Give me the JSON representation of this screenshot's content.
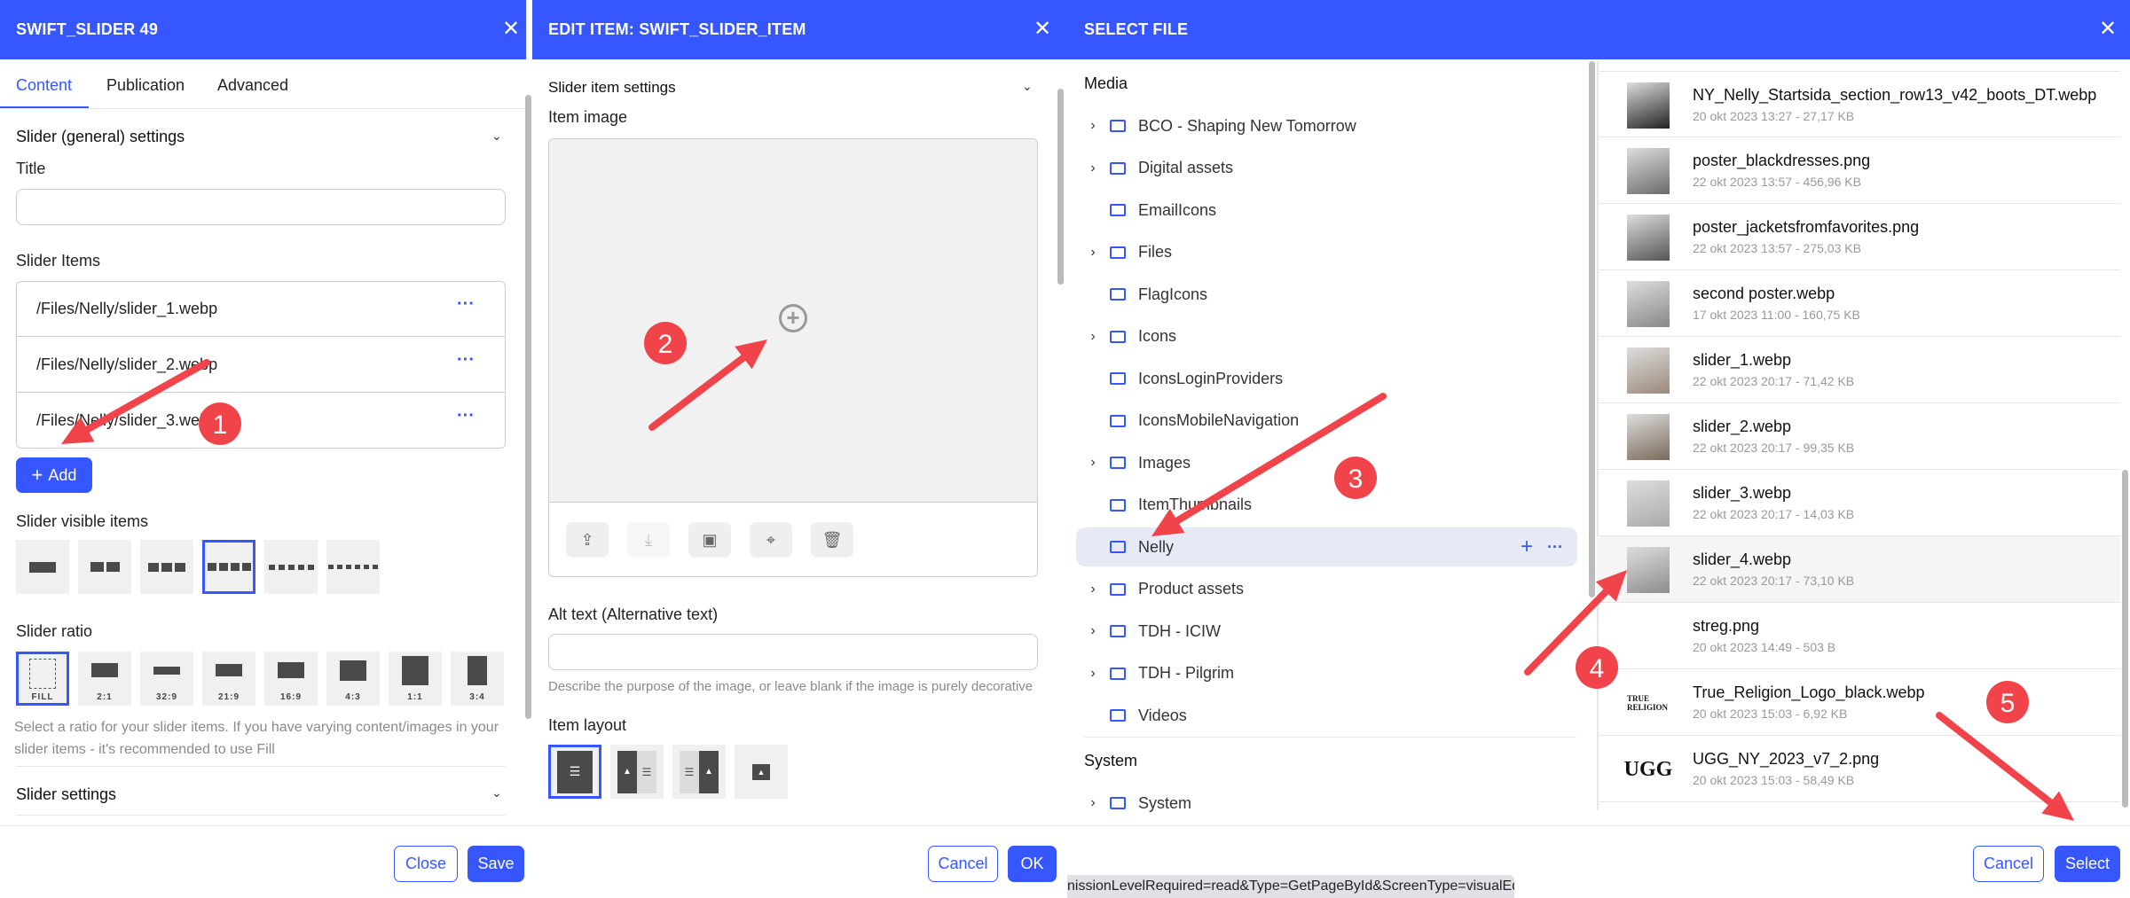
{
  "colors": {
    "accent": "#3657ff",
    "annotation": "#f0444a"
  },
  "panel1": {
    "title": "SWIFT_SLIDER 49",
    "close_icon": "close-icon",
    "tabs": [
      {
        "label": "Content",
        "active": true
      },
      {
        "label": "Publication"
      },
      {
        "label": "Advanced"
      }
    ],
    "section_general": "Slider (general) settings",
    "title_label": "Title",
    "title_value": "",
    "slider_items_label": "Slider Items",
    "slider_items": [
      "/Files/Nelly/slider_1.webp",
      "/Files/Nelly/slider_2.webp",
      "/Files/Nelly/slider_3.webp"
    ],
    "add_label": "Add",
    "visible_items_label": "Slider visible items",
    "visible_items_options": [
      1,
      2,
      3,
      4,
      5,
      6
    ],
    "visible_items_selected": 4,
    "ratio_label": "Slider ratio",
    "ratio_options": [
      "FILL",
      "2:1",
      "32:9",
      "21:9",
      "16:9",
      "4:3",
      "1:1",
      "3:4"
    ],
    "ratio_selected": "FILL",
    "ratio_help": "Select a ratio for your slider items. If you have varying content/images in your slider items - it's recommended to use Fill",
    "section_slider": "Slider settings",
    "close_label": "Close",
    "save_label": "Save"
  },
  "panel2": {
    "title": "EDIT ITEM: SWIFT_SLIDER_ITEM",
    "section": "Slider item settings",
    "item_image_label": "Item image",
    "image_tools": [
      "upload-icon",
      "download-icon",
      "folder-icon",
      "focal-point-icon",
      "trash-icon"
    ],
    "alt_label": "Alt text (Alternative text)",
    "alt_value": "",
    "alt_help": "Describe the purpose of the image, or leave blank if the image is purely decorative",
    "layout_label": "Item layout",
    "layout_options": [
      "text-only",
      "image-left",
      "image-right",
      "image-only"
    ],
    "layout_selected": "text-only",
    "cancel_label": "Cancel",
    "ok_label": "OK"
  },
  "panel3": {
    "title": "SELECT FILE",
    "media_label": "Media",
    "folders": [
      {
        "name": "BCO - Shaping New Tomorrow",
        "expandable": true
      },
      {
        "name": "Digital assets",
        "expandable": true
      },
      {
        "name": "EmailIcons",
        "expandable": false
      },
      {
        "name": "Files",
        "expandable": true
      },
      {
        "name": "FlagIcons",
        "expandable": false
      },
      {
        "name": "Icons",
        "expandable": true
      },
      {
        "name": "IconsLoginProviders",
        "expandable": false
      },
      {
        "name": "IconsMobileNavigation",
        "expandable": false
      },
      {
        "name": "Images",
        "expandable": true
      },
      {
        "name": "ItemThumbnails",
        "expandable": false
      },
      {
        "name": "Nelly",
        "expandable": false,
        "selected": true
      },
      {
        "name": "Product assets",
        "expandable": true
      },
      {
        "name": "TDH - ICIW",
        "expandable": true
      },
      {
        "name": "TDH - Pilgrim",
        "expandable": true
      },
      {
        "name": "Videos",
        "expandable": false
      }
    ],
    "system_label": "System",
    "system_folders": [
      {
        "name": "System",
        "expandable": true
      }
    ],
    "files": [
      {
        "name": "NY_Nelly_Startsida_section_row13_v42_boots_DT.webp",
        "meta": "20 okt 2023 13:27 - 27,17 KB"
      },
      {
        "name": "poster_blackdresses.png",
        "meta": "22 okt 2023 13:57 - 456,96 KB"
      },
      {
        "name": "poster_jacketsfromfavorites.png",
        "meta": "22 okt 2023 13:57 - 275,03 KB"
      },
      {
        "name": "second poster.webp",
        "meta": "17 okt 2023 11:00 - 160,75 KB"
      },
      {
        "name": "slider_1.webp",
        "meta": "22 okt 2023 20:17 - 71,42 KB"
      },
      {
        "name": "slider_2.webp",
        "meta": "22 okt 2023 20:17 - 99,35 KB"
      },
      {
        "name": "slider_3.webp",
        "meta": "22 okt 2023 20:17 - 14,03 KB"
      },
      {
        "name": "slider_4.webp",
        "meta": "22 okt 2023 20:17 - 73,10 KB",
        "selected": true
      },
      {
        "name": "streg.png",
        "meta": "20 okt 2023 14:49 - 503 B"
      },
      {
        "name": "True_Religion_Logo_black.webp",
        "meta": "20 okt 2023 15:03 - 6,92 KB",
        "logo": "TRUE RELIGION"
      },
      {
        "name": "UGG_NY_2023_v7_2.png",
        "meta": "20 okt 2023 15:03 - 58,49 KB",
        "logo": "UGG"
      }
    ],
    "cancel_label": "Cancel",
    "select_label": "Select"
  },
  "status_url": "nissionLevelRequired=read&Type=GetPageById&ScreenType=visualEditor#",
  "annotations": [
    "1",
    "2",
    "3",
    "4",
    "5"
  ]
}
